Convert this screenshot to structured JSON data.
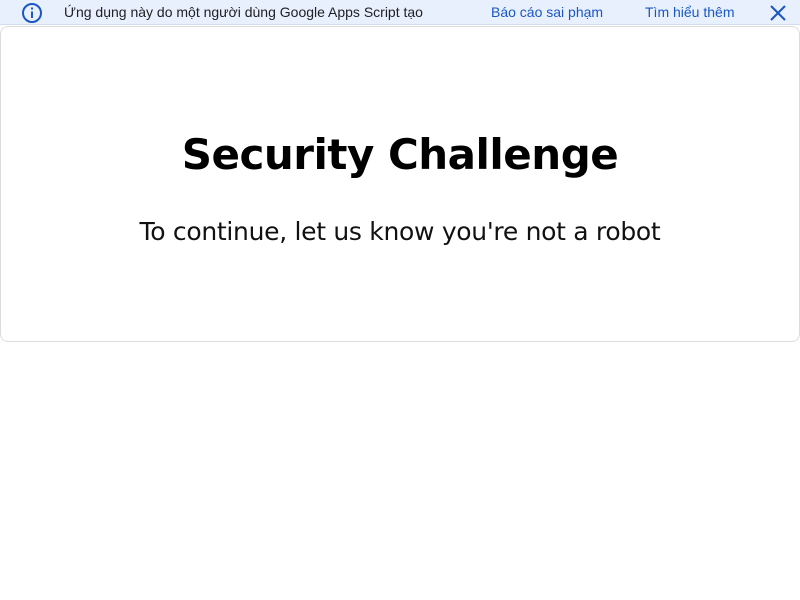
{
  "banner": {
    "message": "Ứng dụng này do một người dùng Google Apps Script tạo",
    "report_link": "Báo cáo sai phạm",
    "learn_more_link": "Tìm hiểu thêm",
    "icons": {
      "info": "info-icon",
      "close": "close-icon"
    },
    "colors": {
      "background": "#e8f0fe",
      "link": "#1a57c4",
      "icon": "#1a57c4"
    }
  },
  "challenge": {
    "title": "Security Challenge",
    "subtitle": "To continue, let us know you're not a robot"
  }
}
